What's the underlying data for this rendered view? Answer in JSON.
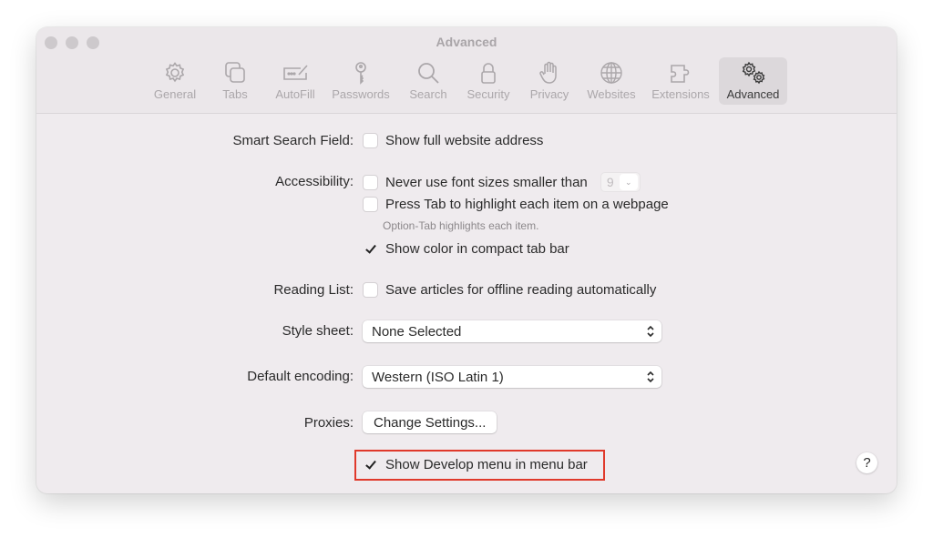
{
  "window": {
    "title": "Advanced"
  },
  "toolbar": {
    "items": [
      {
        "label": "General",
        "icon": "gear-icon"
      },
      {
        "label": "Tabs",
        "icon": "tabs-icon"
      },
      {
        "label": "AutoFill",
        "icon": "autofill-icon"
      },
      {
        "label": "Passwords",
        "icon": "key-icon"
      },
      {
        "label": "Search",
        "icon": "search-icon"
      },
      {
        "label": "Security",
        "icon": "lock-icon"
      },
      {
        "label": "Privacy",
        "icon": "hand-icon"
      },
      {
        "label": "Websites",
        "icon": "globe-icon"
      },
      {
        "label": "Extensions",
        "icon": "puzzle-icon"
      },
      {
        "label": "Advanced",
        "icon": "gears-icon",
        "active": true
      }
    ]
  },
  "settings": {
    "smart_search": {
      "label": "Smart Search Field:",
      "option": "Show full website address",
      "checked": false
    },
    "accessibility": {
      "label": "Accessibility:",
      "font_size_option": "Never use font sizes smaller than",
      "font_size_checked": false,
      "font_size_value": "9",
      "tab_highlight_option": "Press Tab to highlight each item on a webpage",
      "tab_highlight_checked": false,
      "tab_highlight_hint": "Option-Tab highlights each item.",
      "compact_color_option": "Show color in compact tab bar",
      "compact_color_checked": true
    },
    "reading_list": {
      "label": "Reading List:",
      "option": "Save articles for offline reading automatically",
      "checked": false
    },
    "style_sheet": {
      "label": "Style sheet:",
      "value": "None Selected"
    },
    "default_encoding": {
      "label": "Default encoding:",
      "value": "Western (ISO Latin 1)"
    },
    "proxies": {
      "label": "Proxies:",
      "button": "Change Settings..."
    },
    "develop_menu": {
      "option": "Show Develop menu in menu bar",
      "checked": true,
      "highlight_color": "#e0392b"
    }
  },
  "help": {
    "label": "?"
  }
}
